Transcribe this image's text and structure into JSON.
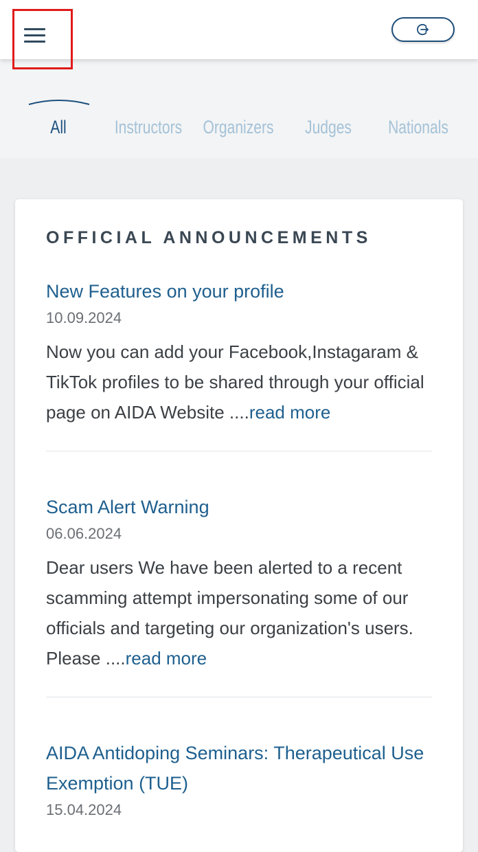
{
  "header": {
    "menu_icon": "hamburger-menu-icon",
    "logout_icon": "logout-icon",
    "highlight_color": "#e01b1b",
    "accent_color": "#1d4e7a"
  },
  "tabs": [
    {
      "label": "All",
      "active": true
    },
    {
      "label": "Instructors",
      "active": false
    },
    {
      "label": "Organizers",
      "active": false
    },
    {
      "label": "Judges",
      "active": false
    },
    {
      "label": "Nationals",
      "active": false
    }
  ],
  "section": {
    "heading": "OFFICIAL ANNOUNCEMENTS"
  },
  "posts": [
    {
      "title": "New Features on your profile",
      "date": "10.09.2024",
      "excerpt": "Now you can add your Facebook,Instagaram & TikTok profiles to be shared through your official page on AIDA Website ....",
      "read_more": "read more"
    },
    {
      "title": "Scam Alert Warning",
      "date": "06.06.2024",
      "excerpt": "Dear users We have been alerted to a recent scamming attempt impersonating some of our officials and targeting our organization's users. Please ....",
      "read_more": "read more"
    },
    {
      "title": "AIDA Antidoping Seminars: Therapeutical Use Exemption (TUE)",
      "date": "15.04.2024"
    }
  ]
}
